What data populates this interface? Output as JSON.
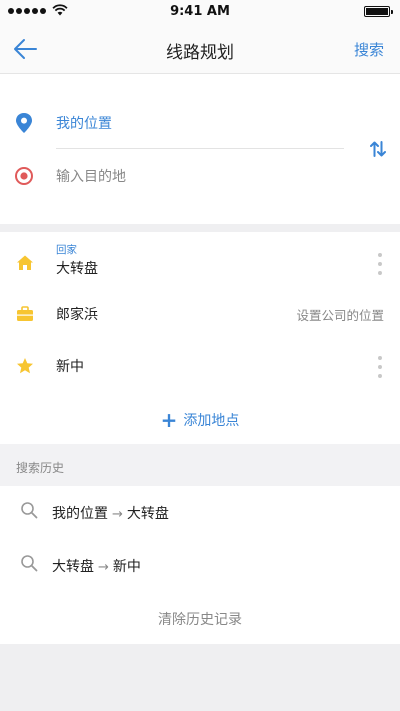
{
  "status_bar": {
    "time": "9:41 AM"
  },
  "nav": {
    "title": "线路规划",
    "search_label": "搜索"
  },
  "route": {
    "from": "我的位置",
    "to_placeholder": "输入目的地"
  },
  "places": {
    "home": {
      "tag": "回家",
      "name": "大转盘"
    },
    "work": {
      "name": "郎家浜",
      "hint": "设置公司的位置"
    },
    "favorite": {
      "name": "新中"
    },
    "add_label": "添加地点"
  },
  "history": {
    "title": "搜索历史",
    "items": [
      {
        "from": "我的位置",
        "to": "大转盘"
      },
      {
        "from": "大转盘",
        "to": "新中"
      }
    ],
    "clear_label": "清除历史记录"
  },
  "colors": {
    "accent": "#3a85d6",
    "destination_pin": "#e05a5a",
    "home_icon": "#f7c531",
    "work_icon": "#f7c531",
    "star_icon": "#f7c531"
  }
}
